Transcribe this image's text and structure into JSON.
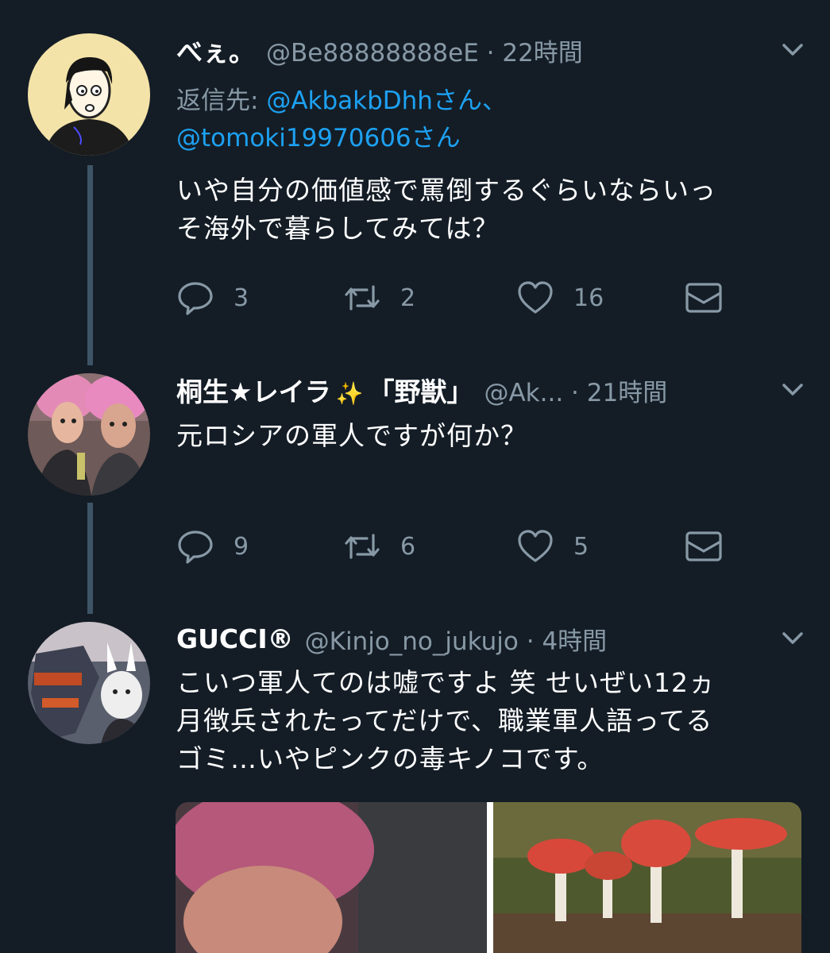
{
  "tweets": [
    {
      "name": "べぇ。",
      "handle": "@Be88888888eE",
      "time": "22時間",
      "reply_prefix": "返信先: ",
      "reply_mention_1": "@AkbakbDhhさん、",
      "reply_mention_2": "@tomoki19970606さん",
      "text_line_1": "いや自分の価値感で罵倒するぐらいならいっ",
      "text_line_2": "そ海外で暮らしてみては？",
      "replies": "3",
      "retweets": "2",
      "likes": "16"
    },
    {
      "name_part_1": "桐生★レイラ",
      "name_part_2": "「野獣」",
      "handle": "@Ak...",
      "time": "21時間",
      "text_line_1": "元ロシアの軍人ですが何か？",
      "replies": "9",
      "retweets": "6",
      "likes": "5"
    },
    {
      "name": "GUCCI®",
      "handle": "@Kinjo_no_jukujo",
      "time": "4時間",
      "text_line_1": "こいつ軍人てのは嘘ですよ 笑  せいぜい12ヵ",
      "text_line_2": "月徴兵されたってだけで、職業軍人語ってる",
      "text_line_3": "ゴミ…いやピンクの毒キノコです。"
    }
  ],
  "separator": " · ",
  "icons": [
    "chevron-down-icon",
    "reply-icon",
    "retweet-icon",
    "like-icon",
    "dm-icon",
    "sparkle-emoji"
  ],
  "colors": {
    "background": "#141d26",
    "secondary_text": "#8899a6",
    "link": "#1da1f2",
    "thread_line": "#3d5466"
  }
}
